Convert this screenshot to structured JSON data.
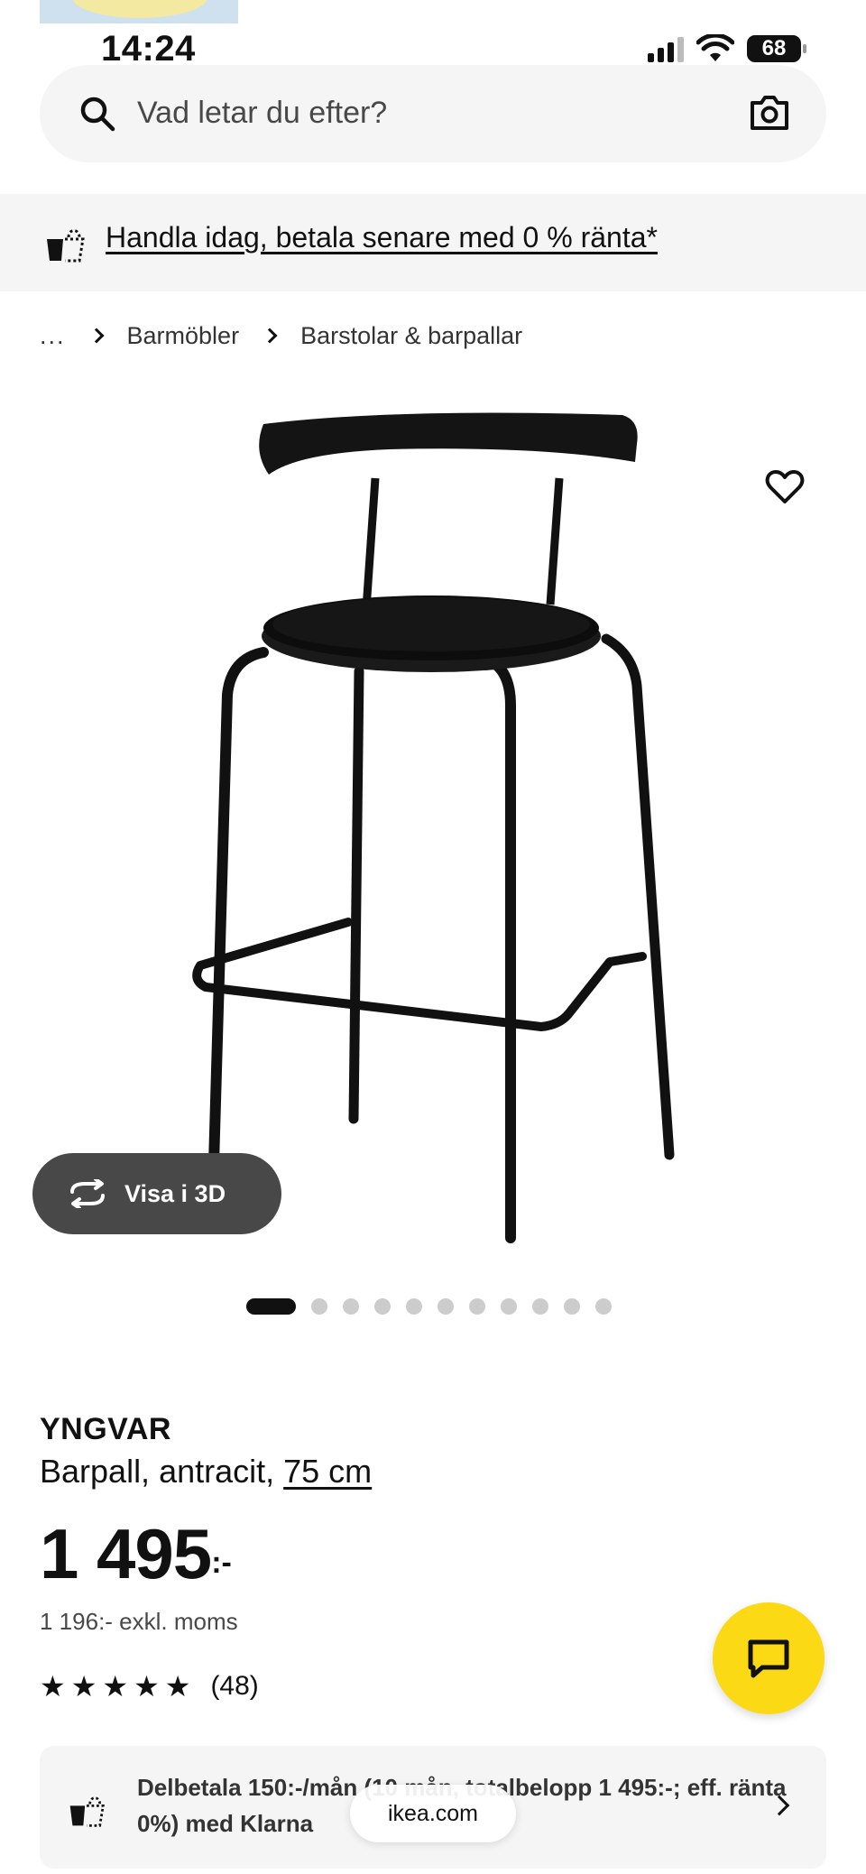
{
  "status_bar": {
    "time": "14:24",
    "battery": "68"
  },
  "search": {
    "placeholder": "Vad letar du efter?"
  },
  "promo": {
    "text": "Handla idag, betala senare med 0 % ränta*"
  },
  "breadcrumb": {
    "ellipsis": "...",
    "items": [
      "Barmöbler",
      "Barstolar & barpallar"
    ]
  },
  "product": {
    "name": "YNGVAR",
    "description": "Barpall, antracit,",
    "size": "75 cm",
    "price": "1 495",
    "price_suffix": ":-",
    "price_ex_vat": "1 196:- exkl. moms",
    "rating_stars": 5,
    "rating_count": "(48)"
  },
  "gallery": {
    "view3d_label": "Visa i 3D",
    "total_images": 12,
    "active_index": 0
  },
  "installment": {
    "text": "Delbetala 150:-/mån (10 mån, totalbelopp 1 495:-; eff. ränta 0%) med Klarna"
  },
  "browser": {
    "url": "ikea.com"
  },
  "icons": {
    "search": "search-icon",
    "camera": "camera-icon",
    "promo": "shopping-bag-icon",
    "favorite": "heart-icon",
    "view3d": "rotate-3d-icon",
    "chat": "chat-icon",
    "chevron": "chevron-right-icon"
  },
  "colors": {
    "accent_yellow": "#fbd914",
    "dark_button": "#484848",
    "panel_grey": "#f5f5f5"
  }
}
